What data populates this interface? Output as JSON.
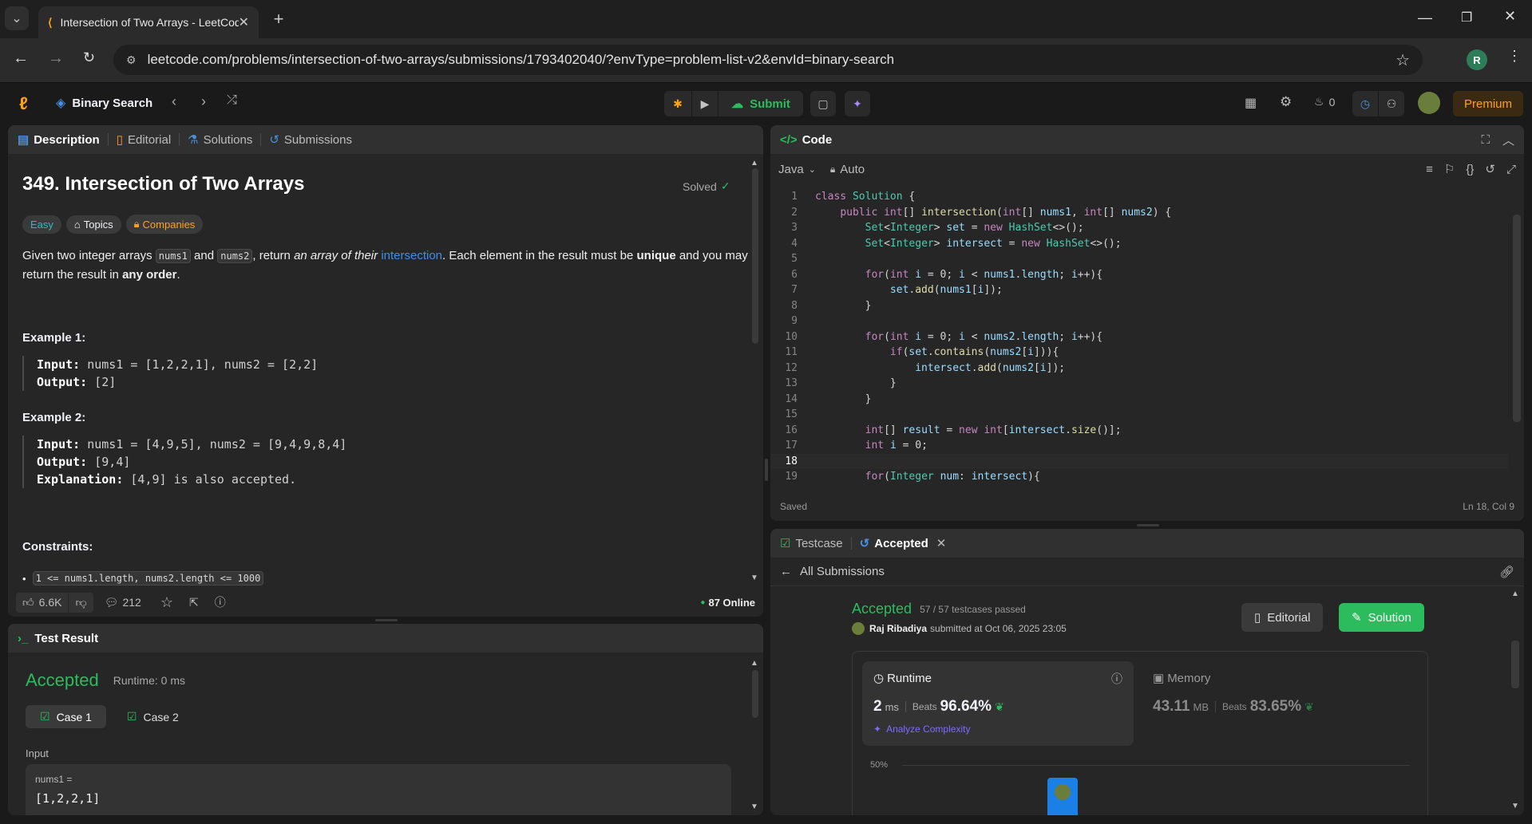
{
  "browser": {
    "tab_title": "Intersection of Two Arrays - LeetCode",
    "url": "leetcode.com/problems/intersection-of-two-arrays/submissions/1793402040/?envType=problem-list-v2&envId=binary-search",
    "profile_initial": "R"
  },
  "nav": {
    "list_name": "Binary Search",
    "submit_label": "Submit",
    "streak_count": "0",
    "premium_label": "Premium"
  },
  "desc_tabs": {
    "description": "Description",
    "editorial": "Editorial",
    "solutions": "Solutions",
    "submissions": "Submissions"
  },
  "problem": {
    "title": "349. Intersection of Two Arrays",
    "solved": "Solved",
    "difficulty": "Easy",
    "topics": "Topics",
    "companies": "Companies",
    "p1": "Given two integer arrays",
    "nums1": "nums1",
    "p2": "and",
    "nums2": "nums2",
    "p3": ", return",
    "p4": "an array of their",
    "link": "intersection",
    "p5": ". Each element in the result must be",
    "unique": "unique",
    "p6": "and you may return the result in",
    "any_order": "any order",
    "p7": ".",
    "ex1_title": "Example 1:",
    "ex1_input_label": "Input:",
    "ex1_input": "nums1 = [1,2,2,1], nums2 = [2,2]",
    "ex1_output_label": "Output:",
    "ex1_output": "[2]",
    "ex2_title": "Example 2:",
    "ex2_input_label": "Input:",
    "ex2_input": "nums1 = [4,9,5], nums2 = [9,4,9,8,4]",
    "ex2_output_label": "Output:",
    "ex2_output": "[9,4]",
    "ex2_expl_label": "Explanation:",
    "ex2_expl": "[4,9] is also accepted.",
    "constraints_title": "Constraints:",
    "constraint1": "1 <= nums1.length, nums2.length <= 1000"
  },
  "footer": {
    "likes": "6.6K",
    "comments": "212",
    "online": "87 Online"
  },
  "test_result": {
    "header": "Test Result",
    "status": "Accepted",
    "runtime": "Runtime: 0 ms",
    "case1": "Case 1",
    "case2": "Case 2",
    "input_label": "Input",
    "var_label": "nums1 =",
    "var_value": "[1,2,2,1]"
  },
  "code": {
    "header": "Code",
    "language": "Java",
    "mode": "Auto",
    "saved": "Saved",
    "cursor": "Ln 18, Col 9",
    "lines": [
      "class Solution {",
      "    public int[] intersection(int[] nums1, int[] nums2) {",
      "        Set<Integer> set = new HashSet<>();",
      "        Set<Integer> intersect = new HashSet<>();",
      "",
      "        for(int i = 0; i < nums1.length; i++){",
      "            set.add(nums1[i]);",
      "        }",
      "",
      "        for(int i = 0; i < nums2.length; i++){",
      "            if(set.contains(nums2[i])){",
      "                intersect.add(nums2[i]);",
      "            }",
      "        }",
      "",
      "        int[] result = new int[intersect.size()];",
      "        int i = 0;",
      "",
      "        for(Integer num: intersect){"
    ]
  },
  "submission": {
    "tab_testcase": "Testcase",
    "tab_accepted": "Accepted",
    "all_submissions": "All Submissions",
    "status": "Accepted",
    "passed": "57 / 57 testcases passed",
    "user": "Raj Ribadiya",
    "submitted_at": "submitted at Oct 06, 2025 23:05",
    "editorial_btn": "Editorial",
    "solution_btn": "Solution",
    "runtime_label": "Runtime",
    "runtime_value": "2",
    "runtime_unit": "ms",
    "beats_label": "Beats",
    "runtime_beats": "96.64%",
    "analyze": "Analyze Complexity",
    "memory_label": "Memory",
    "memory_value": "43.11",
    "memory_unit": "MB",
    "memory_beats": "83.65%",
    "axis_50": "50%"
  }
}
